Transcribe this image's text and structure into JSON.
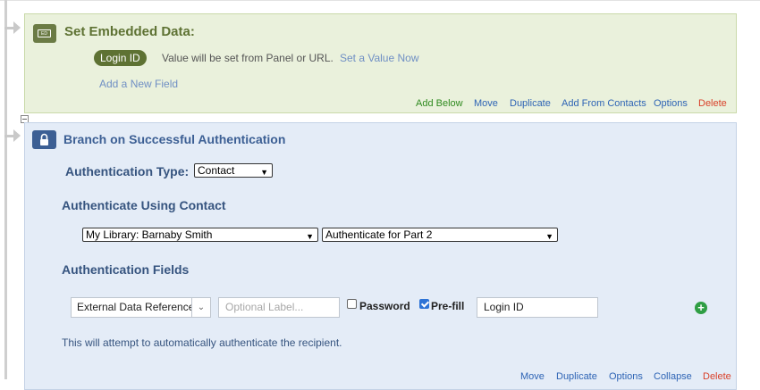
{
  "embedded": {
    "title": "Set Embedded Data:",
    "badge": "ED",
    "field_pill": "Login ID",
    "message": "Value will be set from Panel or URL.",
    "set_value_link": "Set a Value Now",
    "add_field_link": "Add a New Field",
    "footer": {
      "add_below": "Add Below",
      "move": "Move",
      "duplicate": "Duplicate",
      "add_from_contacts": "Add From Contacts",
      "options": "Options",
      "delete": "Delete"
    }
  },
  "branch": {
    "title": "Branch on Successful Authentication",
    "auth_type_label": "Authentication Type:",
    "auth_type_value": "Contact",
    "auth_using_heading": "Authenticate Using Contact",
    "library_value": "My Library: Barnaby Smith",
    "contact_list_value": "Authenticate for Part 2",
    "fields_heading": "Authentication Fields",
    "field_type_value": "External Data Reference",
    "optional_label_placeholder": "Optional Label...",
    "password_label": "Password",
    "prefill_label": "Pre-fill",
    "prefill_checked": true,
    "password_checked": false,
    "field_value": "Login ID",
    "note": "This will attempt to automatically authenticate the recipient.",
    "footer": {
      "move": "Move",
      "duplicate": "Duplicate",
      "options": "Options",
      "collapse": "Collapse",
      "delete": "Delete"
    }
  },
  "colors": {
    "green_bg": "#eaf1dc",
    "green_accent": "#5e7233",
    "blue_bg": "#e4ecf7",
    "blue_accent": "#3c5f94",
    "link_blue": "#2e64b5",
    "link_green": "#2f8a1f",
    "delete_red": "#d9412a"
  }
}
